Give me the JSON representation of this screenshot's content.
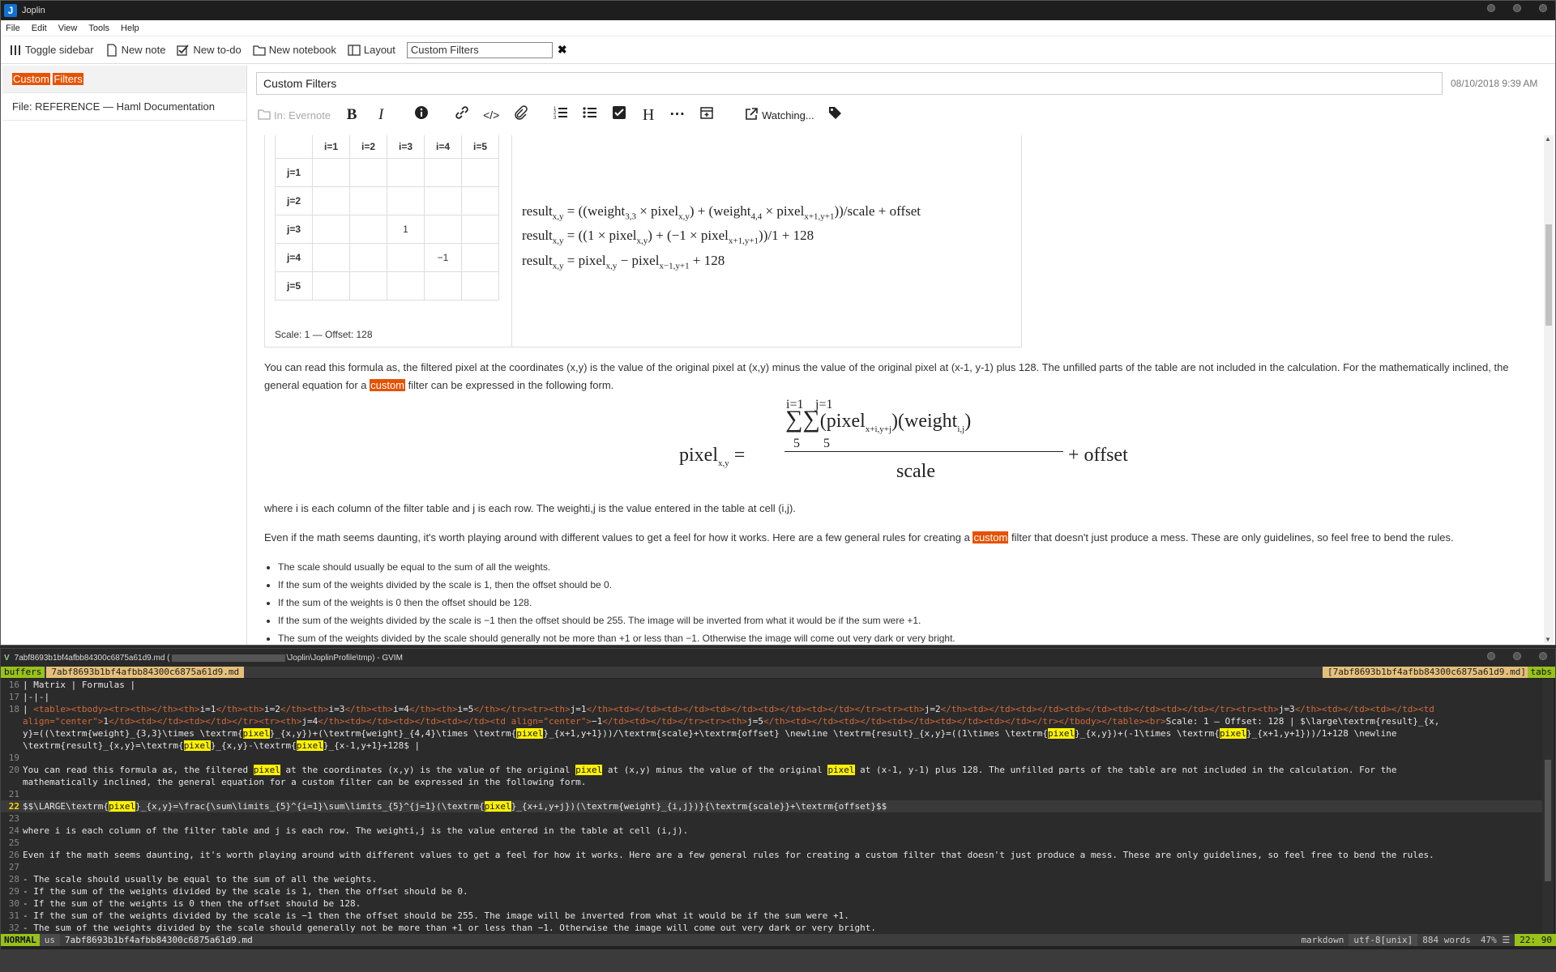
{
  "joplin": {
    "window_title": "Joplin",
    "menu": [
      "File",
      "Edit",
      "View",
      "Tools",
      "Help"
    ],
    "toolbar": {
      "toggle_sidebar": "Toggle sidebar",
      "new_note": "New note",
      "new_todo": "New to-do",
      "new_notebook": "New notebook",
      "layout": "Layout",
      "search_value": "Custom Filters"
    },
    "sidebar": {
      "items": [
        {
          "label_parts": [
            "Custom",
            "Filters"
          ],
          "highlighted": true
        },
        {
          "label": "File: REFERENCE — Haml Documentation"
        }
      ]
    },
    "note": {
      "title": "Custom Filters",
      "date": "08/10/2018 9:39 AM",
      "editor_toolbar": {
        "notebook": "In: Evernote",
        "watching": "Watching..."
      },
      "matrix": {
        "col_headers": [
          "i=1",
          "i=2",
          "i=3",
          "i=4",
          "i=5"
        ],
        "rows": [
          {
            "h": "j=1",
            "cells": [
              "",
              "",
              "",
              "",
              ""
            ]
          },
          {
            "h": "j=2",
            "cells": [
              "",
              "",
              "",
              "",
              ""
            ]
          },
          {
            "h": "j=3",
            "cells": [
              "",
              "",
              "1",
              "",
              ""
            ]
          },
          {
            "h": "j=4",
            "cells": [
              "",
              "",
              "",
              "−1",
              ""
            ]
          },
          {
            "h": "j=5",
            "cells": [
              "",
              "",
              "",
              "",
              ""
            ]
          }
        ],
        "scale_line": "Scale: 1 — Offset: 128"
      },
      "formulas": [
        "result<sub>x,y</sub> = ((weight<sub>3,3</sub> × pixel<sub>x,y</sub>) + (weight<sub>4,4</sub> × pixel<sub>x+1,y+1</sub>))/scale + offset",
        "result<sub>x,y</sub> = ((1 × pixel<sub>x,y</sub>) + (−1 × pixel<sub>x+1,y+1</sub>))/1 + 128",
        "result<sub>x,y</sub> = pixel<sub>x,y</sub> − pixel<sub>x−1,y+1</sub> + 128"
      ],
      "para1_before": "You can read this formula as, the filtered pixel at the coordinates (x,y) is the value of the original pixel at (x,y) minus the value of the original pixel at (x-1, y-1) plus 128. The unfilled parts of the table are not included in the calculation. For the mathematically inclined, the general equation for a",
      "para1_hl": "custom",
      "para1_after": "filter can be expressed in the following form.",
      "para2": "where i is each column of the filter table and j is each row. The weighti,j is the value entered in the table at cell (i,j).",
      "para3_before": "Even if the math seems daunting, it's worth playing around with different values to get a feel for how it works. Here are a few general rules for creating a",
      "para3_hl": "custom",
      "para3_after": "filter that doesn't just produce a mess. These are only guidelines, so feel free to bend the rules.",
      "rules": [
        "The scale should usually be equal to the sum of all the weights.",
        "If the sum of the weights divided by the scale is 1, then the offset should be 0.",
        "If the sum of the weights is 0 then the offset should be 128.",
        "If the sum of the weights divided by the scale is −1 then the offset should be 255. The image will be inverted from what it would be if the sum were +1.",
        "The sum of the weights divided by the scale should generally not be more than +1 or less than −1. Otherwise the image will come out very dark or very bright."
      ]
    }
  },
  "gvim": {
    "window_title_left": "7abf8693b1bf4afbb84300c6875a61d9.md (",
    "window_title_right": "\\Joplin\\JoplinProfile\\tmp) - GVIM",
    "tabline": {
      "buffers": "buffers",
      "current": "7abf8693b1bf4afbb84300c6875a61d9.md",
      "right_current": "[7abf8693b1bf4afbb84300c6875a61d9.md]",
      "tabs": "tabs"
    },
    "lines": [
      {
        "n": "16",
        "t": "| Matrix | Formulas |"
      },
      {
        "n": "17",
        "t": "|-|-|"
      },
      {
        "n": "18",
        "html": "| <span class=\"tag\">&lt;table&gt;&lt;tbody&gt;&lt;tr&gt;&lt;th&gt;&lt;/th&gt;&lt;th&gt;</span>i=1<span class=\"tag\">&lt;/th&gt;&lt;th&gt;</span>i=2<span class=\"tag\">&lt;/th&gt;&lt;th&gt;</span>i=3<span class=\"tag\">&lt;/th&gt;&lt;th&gt;</span>i=4<span class=\"tag\">&lt;/th&gt;&lt;th&gt;</span>i=5<span class=\"tag\">&lt;/th&gt;&lt;/tr&gt;&lt;tr&gt;&lt;th&gt;</span>j=1<span class=\"tag\">&lt;/th&gt;&lt;td&gt;&lt;/td&gt;&lt;td&gt;&lt;/td&gt;&lt;td&gt;&lt;/td&gt;&lt;td&gt;&lt;/td&gt;&lt;td&gt;&lt;/td&gt;&lt;/tr&gt;&lt;tr&gt;&lt;th&gt;</span>j=2<span class=\"tag\">&lt;/th&gt;&lt;td&gt;&lt;/td&gt;&lt;td&gt;&lt;/td&gt;&lt;td&gt;&lt;/td&gt;&lt;td&gt;&lt;/td&gt;&lt;td&gt;&lt;/td&gt;&lt;/tr&gt;&lt;tr&gt;&lt;th&gt;</span>j=3<span class=\"tag\">&lt;/th&gt;&lt;td&gt;&lt;/td&gt;&lt;td&gt;&lt;/td&gt;&lt;td</span>"
      },
      {
        "n": "",
        "html": "<span class=\"tag\">align=\"center\"&gt;</span>1<span class=\"tag\">&lt;/td&gt;&lt;td&gt;&lt;/td&gt;&lt;td&gt;&lt;/td&gt;&lt;/tr&gt;&lt;tr&gt;&lt;th&gt;</span>j=4<span class=\"tag\">&lt;/th&gt;&lt;td&gt;&lt;/td&gt;&lt;td&gt;&lt;/td&gt;&lt;td&gt;&lt;/td&gt;&lt;td align=\"center\"&gt;</span>−1<span class=\"tag\">&lt;/td&gt;&lt;td&gt;&lt;/td&gt;&lt;/tr&gt;&lt;tr&gt;&lt;th&gt;</span>j=5<span class=\"tag\">&lt;/th&gt;&lt;td&gt;&lt;/td&gt;&lt;td&gt;&lt;/td&gt;&lt;td&gt;&lt;/td&gt;&lt;td&gt;&lt;/td&gt;&lt;td&gt;&lt;/td&gt;&lt;/tr&gt;&lt;/tbody&gt;&lt;/table&gt;&lt;br&gt;</span>Scale: 1 — Offset: 128 | $\\large\\textrm{result}_{x,"
      },
      {
        "n": "",
        "html": "y}=((\\textrm{weight}_{3,3}\\times \\textrm{<span class=\"yhl\">pixel</span>}_{x,y})+(\\textrm{weight}_{4,4}\\times \\textrm{<span class=\"yhl\">pixel</span>}_{x+1,y+1}))/\\textrm{scale}+\\textrm{offset} \\newline \\textrm{result}_{x,y}=((1\\times \\textrm{<span class=\"yhl\">pixel</span>}_{x,y})+(-1\\times \\textrm{<span class=\"yhl\">pixel</span>}_{x+1,y+1}))/1+128 \\newline"
      },
      {
        "n": "",
        "html": "\\textrm{result}_{x,y}=\\textrm{<span class=\"yhl\">pixel</span>}_{x,y}-\\textrm{<span class=\"yhl\">pixel</span>}_{x-1,y+1}+128$ |"
      },
      {
        "n": "19",
        "t": ""
      },
      {
        "n": "20",
        "html": "You can read this formula as, the filtered <span class=\"yhl\">pixel</span> at the coordinates (x,y) is the value of the original <span class=\"yhl\">pixel</span> at (x,y) minus the value of the original <span class=\"yhl\">pixel</span> at (x-1, y-1) plus 128. The unfilled parts of the table are not included in the calculation. For the"
      },
      {
        "n": "",
        "t": "mathematically inclined, the general equation for a custom filter can be expressed in the following form."
      },
      {
        "n": "21",
        "t": ""
      },
      {
        "n": "22",
        "cur": true,
        "html": "$$\\LARGE\\textrm{<span class=\"yhl\">pixel</span>}_{x,y}=\\frac{\\sum\\limits_{5}^{i=1}\\sum\\limits_{5}^{j=1}(\\textrm{<span class=\"yhl\">pixel</span>}_{x+i,y+j})(\\textrm{weight}_{i,j})}{\\textrm{scale}}+\\textrm{offset}$$"
      },
      {
        "n": "23",
        "t": ""
      },
      {
        "n": "24",
        "t": "where i is each column of the filter table and j is each row. The weighti,j is the value entered in the table at cell (i,j)."
      },
      {
        "n": "25",
        "t": ""
      },
      {
        "n": "26",
        "t": "Even if the math seems daunting, it's worth playing around with different values to get a feel for how it works. Here are a few general rules for creating a custom filter that doesn't just produce a mess. These are only guidelines, so feel free to bend the rules."
      },
      {
        "n": "27",
        "t": ""
      },
      {
        "n": "28",
        "t": "- The scale should usually be equal to the sum of all the weights."
      },
      {
        "n": "29",
        "t": "- If the sum of the weights divided by the scale is 1, then the offset should be 0."
      },
      {
        "n": "30",
        "t": "- If the sum of the weights is 0 then the offset should be 128."
      },
      {
        "n": "31",
        "t": "- If the sum of the weights divided by the scale is −1 then the offset should be 255. The image will be inverted from what it would be if the sum were +1."
      },
      {
        "n": "32",
        "t": "- The sum of the weights divided by the scale should generally not be more than +1 or less than −1. Otherwise the image will come out very dark or very bright."
      }
    ],
    "status": {
      "mode": "NORMAL",
      "keyboard": "us",
      "file": "7abf8693b1bf4afbb84300c6875a61d9.md",
      "filetype": "markdown",
      "encoding": "utf-8[unix]",
      "words": "884 words",
      "percent": "47% ☰",
      "position": "22: 90"
    }
  }
}
